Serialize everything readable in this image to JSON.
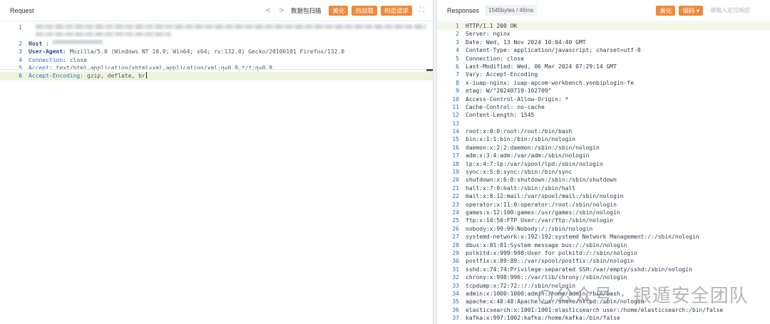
{
  "request": {
    "title": "Request",
    "nav_prev": "<",
    "nav_next": ">",
    "scan_label": "数据包扫描",
    "buttons": [
      "美化",
      "热加载",
      "构造请求"
    ],
    "expand_icon": "expand-icon",
    "lines": [
      {
        "n": "1",
        "type": "blurred"
      },
      {
        "n": "",
        "type": "blurred2"
      },
      {
        "n": "2",
        "key": "Host",
        "sep": " : ",
        "val": "",
        "blur": true
      },
      {
        "n": "3",
        "key": "User-Agent",
        "sep": ": ",
        "val": "Mozilla/5.0 (Windows NT 10.0; Win64; x64; rv:132.0) Gecko/20100101 Firefox/132.0"
      },
      {
        "n": "4",
        "key": "Connection",
        "sep": ": ",
        "val": "close"
      },
      {
        "n": "5",
        "key": "Accept",
        "sep": ": ",
        "val": "text/html,application/xhtml+xml,application/xml;q=0.9,*/*;q=0.8"
      },
      {
        "n": "6",
        "key": "Accept-Encoding",
        "sep": ": ",
        "val": "gzip, deflate, br"
      }
    ]
  },
  "response": {
    "title": "Responses",
    "size_badge": "1545bytes / 46ms",
    "buttons": [
      "美化",
      "编码"
    ],
    "encode_arrow": "▾",
    "search_placeholder": "请输入定位响应",
    "lines": [
      "HTTP/1.1 200 OK",
      "Server: nginx",
      "Date: Wed, 13 Nov 2024 10:04:40 GMT",
      "Content-Type: application/javascript; charset=utf-8",
      "Connection: close",
      "Last-Modified: Wed, 06 Mar 2024 07:29:14 GMT",
      "Vary: Accept-Encoding",
      "x-iuap-nginx: iuap-apcom-workbench.yonbiplogin-fe",
      "etag: W/\"20240719-102709\"",
      "Access-Control-Allow-Origin: *",
      "Cache-Control: no-cache",
      "Content-Length: 1545",
      "",
      "root:x:0:0:root:/root:/bin/bash",
      "bin:x:1:1:bin:/bin:/sbin/nologin",
      "daemon:x:2:2:daemon:/sbin:/sbin/nologin",
      "adm:x:3:4:adm:/var/adm:/sbin/nologin",
      "lp:x:4:7:lp:/var/spool/lpd:/sbin/nologin",
      "sync:x:5:0:sync:/sbin:/bin/sync",
      "shutdown:x:6:0:shutdown:/sbin:/sbin/shutdown",
      "halt:x:7:0:halt:/sbin:/sbin/halt",
      "mail:x:8:12:mail:/var/spool/mail:/sbin/nologin",
      "operator:x:11:0:operator:/root:/sbin/nologin",
      "games:x:12:100:games:/usr/games:/sbin/nologin",
      "ftp:x:14:50:FTP User:/var/ftp:/sbin/nologin",
      "nobody:x:99:99:Nobody:/:/sbin/nologin",
      "systemd-network:x:192:192:systemd Network Management:/:/sbin/nologin",
      "dbus:x:81:81:System message bus:/:/sbin/nologin",
      "polkitd:x:999:998:User for polkitd:/:/sbin/nologin",
      "postfix:x:89:89::/var/spool/postfix:/sbin/nologin",
      "sshd:x:74:74:Privilege-separated SSH:/var/empty/sshd:/sbin/nologin",
      "chrony:x:998:996::/var/lib/chrony:/sbin/nologin",
      "tcpdump:x:72:72::/:/sbin/nologin",
      "admin:x:1000:1000:admin:/home/admin:/bin/bash",
      "apache:x:48:48:Apache:/usr/share/httpd:/sbin/nologin",
      "elasticsearch:x:1001:1001:elasticsearch user:/home/elasticsearch:/bin/false",
      "kafka:x:997:1002:kafka:/home/kafka:/bin/false"
    ]
  },
  "watermark": "公众号 · 银遁安全团队",
  "colors": {
    "accent": "#f0883a",
    "line_number": "#2b6fb5",
    "highlight": "#eef4dc"
  }
}
